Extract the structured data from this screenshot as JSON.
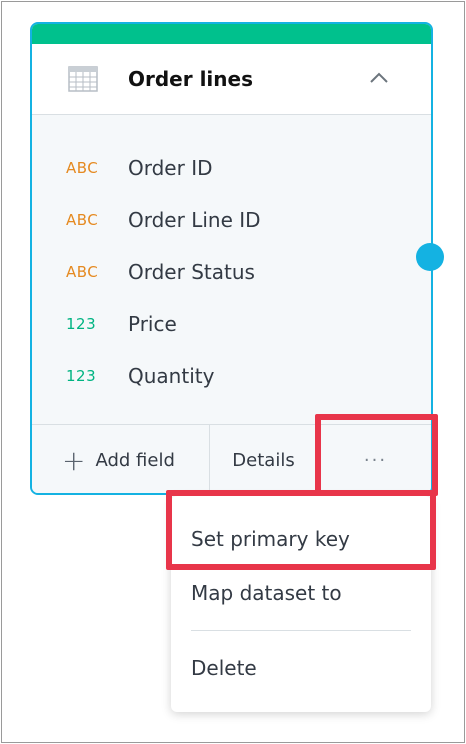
{
  "card": {
    "title": "Order lines",
    "header_icon": "table-icon",
    "collapse_icon": "chevron-up-icon",
    "accent_color": "#00c18d",
    "border_color": "#14b2e2",
    "fields": [
      {
        "type_label": "ABC",
        "type": "text",
        "name": "Order ID"
      },
      {
        "type_label": "ABC",
        "type": "text",
        "name": "Order Line ID"
      },
      {
        "type_label": "ABC",
        "type": "text",
        "name": "Order Status"
      },
      {
        "type_label": "123",
        "type": "number",
        "name": "Price"
      },
      {
        "type_label": "123",
        "type": "number",
        "name": "Quantity"
      }
    ],
    "footer": {
      "add_field_icon": "plus-icon",
      "add_field_label": "Add field",
      "details_label": "Details",
      "more_label": "···"
    }
  },
  "menu": {
    "items": [
      {
        "label": "Set primary key"
      },
      {
        "label": "Map dataset to"
      },
      {
        "label": "Delete"
      }
    ]
  },
  "highlight_color": "#e8354a"
}
